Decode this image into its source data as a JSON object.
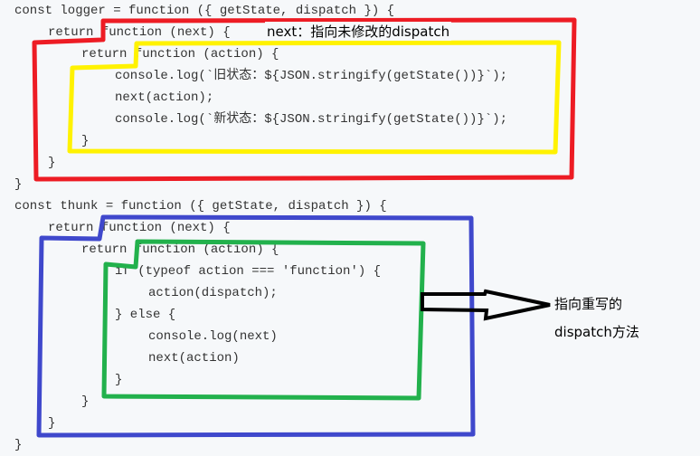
{
  "code_lines": [
    "const logger = function ({ getState, dispatch }) {",
    "return function (next) {",
    "return function (action) {",
    "console.log(`旧状态：${JSON.stringify(getState())}`);",
    "next(action);",
    "console.log(`新状态：${JSON.stringify(getState())}`);",
    "}",
    "}",
    "}",
    "const thunk = function ({ getState, dispatch }) {",
    "return function (next) {",
    "return function (action) {",
    "if (typeof action === 'function') {",
    "action(dispatch);",
    "} else {",
    "console.log(next)",
    "next(action)",
    "}",
    "}",
    "}",
    "}"
  ],
  "annotations": {
    "next_note": "next：指向未修改的dispatch",
    "rewritten_note_line1": "指向重写的",
    "rewritten_note_line2": "dispatch方法"
  },
  "colors": {
    "logger_outer_box": "#ed1c24",
    "logger_inner_box": "#fff200",
    "thunk_outer_box": "#3f48cc",
    "thunk_inner_box": "#22b14c",
    "arrow": "#000000",
    "background": "#f6f8fa",
    "code_text": "#333333"
  }
}
